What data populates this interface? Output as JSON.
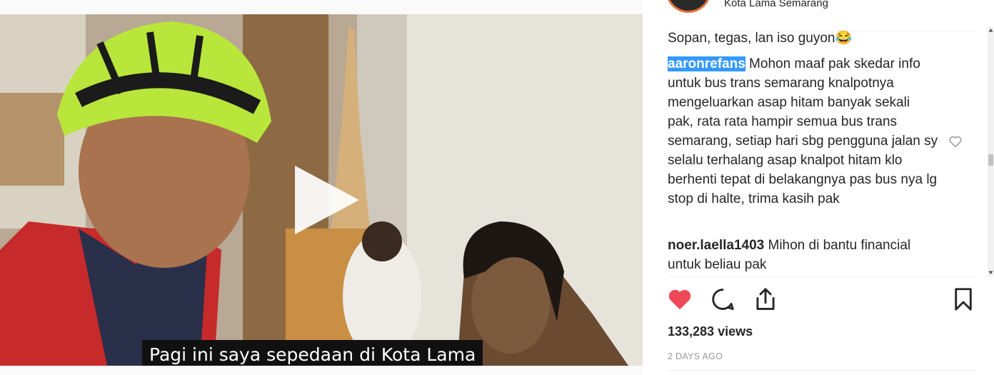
{
  "header": {
    "location": "Kota Lama Semarang"
  },
  "video": {
    "subtitle": "Pagi ini saya sepedaan di Kota Lama"
  },
  "comments": [
    {
      "user": "",
      "text": "Sopan, tegas, lan iso guyon😂"
    },
    {
      "user": "aaronrefans",
      "text": " Mohon maaf pak skedar info untuk bus trans semarang knalpotnya mengeluarkan asap hitam banyak sekali pak, rata rata hampir semua bus trans semarang, setiap hari sbg pengguna jalan sy selalu terhalang asap knalpot hitam klo berhenti tepat di belakangnya pas bus nya lg stop di halte, trima kasih pak"
    },
    {
      "user": "noer.laella1403",
      "text": " Mihon di bantu financial untuk beliau pak"
    }
  ],
  "stats": {
    "views": "133,283 views",
    "time": "2 DAYS AGO"
  },
  "icons": {
    "like": "heart-filled-icon",
    "comment": "speech-bubble-icon",
    "share": "share-icon",
    "save": "bookmark-icon",
    "comment_like": "heart-outline-icon",
    "play": "play-icon"
  },
  "colors": {
    "like": "#ed4956",
    "highlight": "#3399ff",
    "muted": "#999999"
  }
}
